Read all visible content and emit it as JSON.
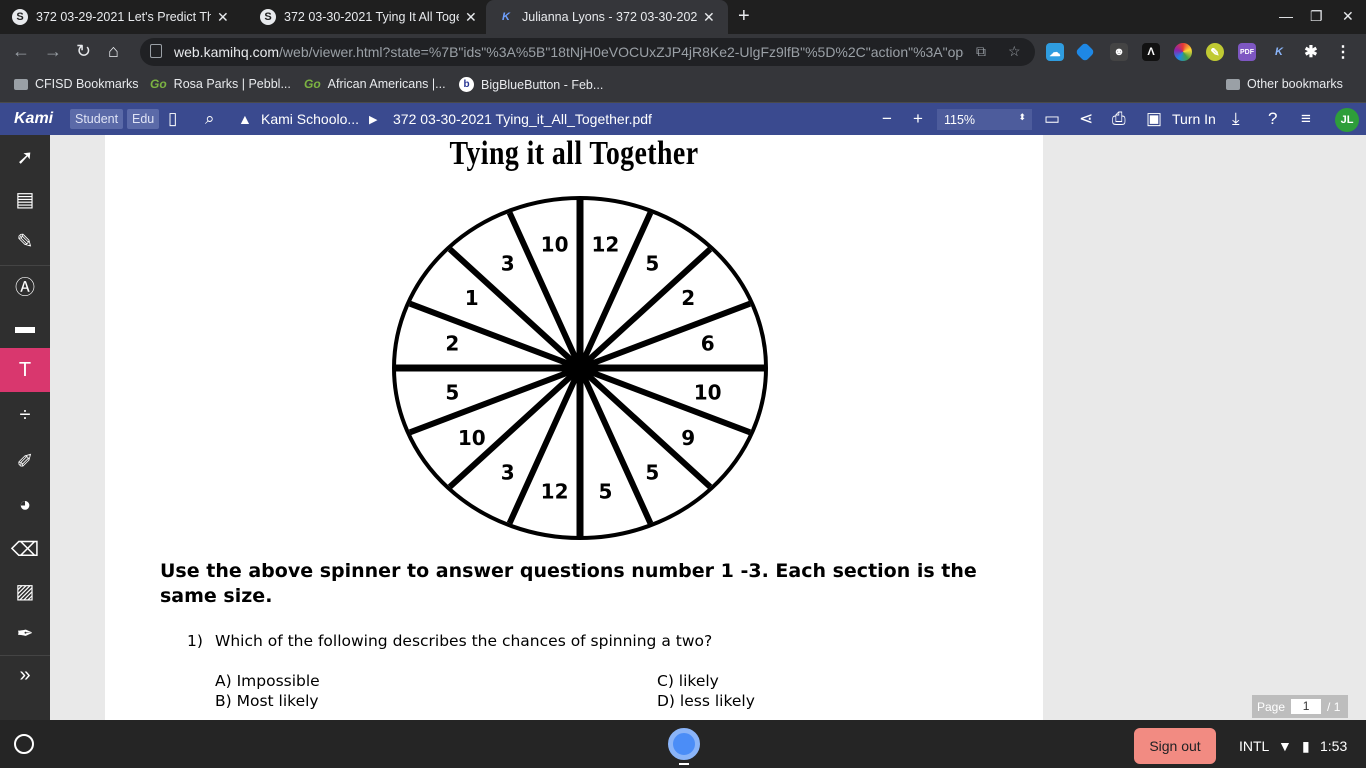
{
  "tabs": [
    {
      "title": "372 03-29-2021 Let's Predict The...",
      "icon": "S"
    },
    {
      "title": "372 03-30-2021 Tying It All Toge...",
      "icon": "S"
    },
    {
      "title": "Julianna Lyons - 372 03-30-2021...",
      "icon": "K",
      "active": true
    }
  ],
  "address": {
    "domain": "web.kamihq.com",
    "path": "/web/viewer.html?state=%7B\"ids\"%3A%5B\"18tNjH0eVOCUxZJP4jR8Ke2-UlgFz9lfB\"%5D%2C\"action\"%3A\"ope..."
  },
  "bookmarks": [
    {
      "label": "CFISD Bookmarks",
      "icon": "folder-icon"
    },
    {
      "label": "Rosa Parks | Pebbl...",
      "icon": "Go"
    },
    {
      "label": "African Americans |...",
      "icon": "Go"
    },
    {
      "label": "BigBlueButton - Feb...",
      "icon": "b"
    }
  ],
  "other_bookmarks": "Other bookmarks",
  "kami": {
    "brand": "Kami",
    "tag_student": "Student",
    "tag_edu": "Edu",
    "drive_path": "Kami Schoolo...",
    "file_name": "372 03-30-2021 Tying_it_All_Together.pdf",
    "zoom": "115%",
    "turn_in": "Turn In",
    "avatar": "JL"
  },
  "text_tool": {
    "font_size": "16",
    "colors": [
      "#000000",
      "#0b5fd8",
      "#9b2be8"
    ]
  },
  "document": {
    "title": "Tying it all Together",
    "spinner_labels": [
      "12",
      "5",
      "2",
      "6",
      "10",
      "9",
      "5",
      "5",
      "12",
      "3",
      "10",
      "5",
      "2",
      "1",
      "3",
      "10"
    ],
    "instructions": "Use the above spinner to answer questions number 1 -3.  Each section is the same size.",
    "question1_number": "1)",
    "question1": "Which of the following describes the chances of spinning a two?",
    "options": {
      "a": "A)  Impossible",
      "b": "B)  Most likely",
      "c": "C) likely",
      "d": "D) less likely"
    }
  },
  "pager": {
    "label": "Page",
    "current": "1",
    "total": "/ 1"
  },
  "shelf": {
    "sign_out": "Sign out",
    "ime": "INTL",
    "time": "1:53"
  }
}
